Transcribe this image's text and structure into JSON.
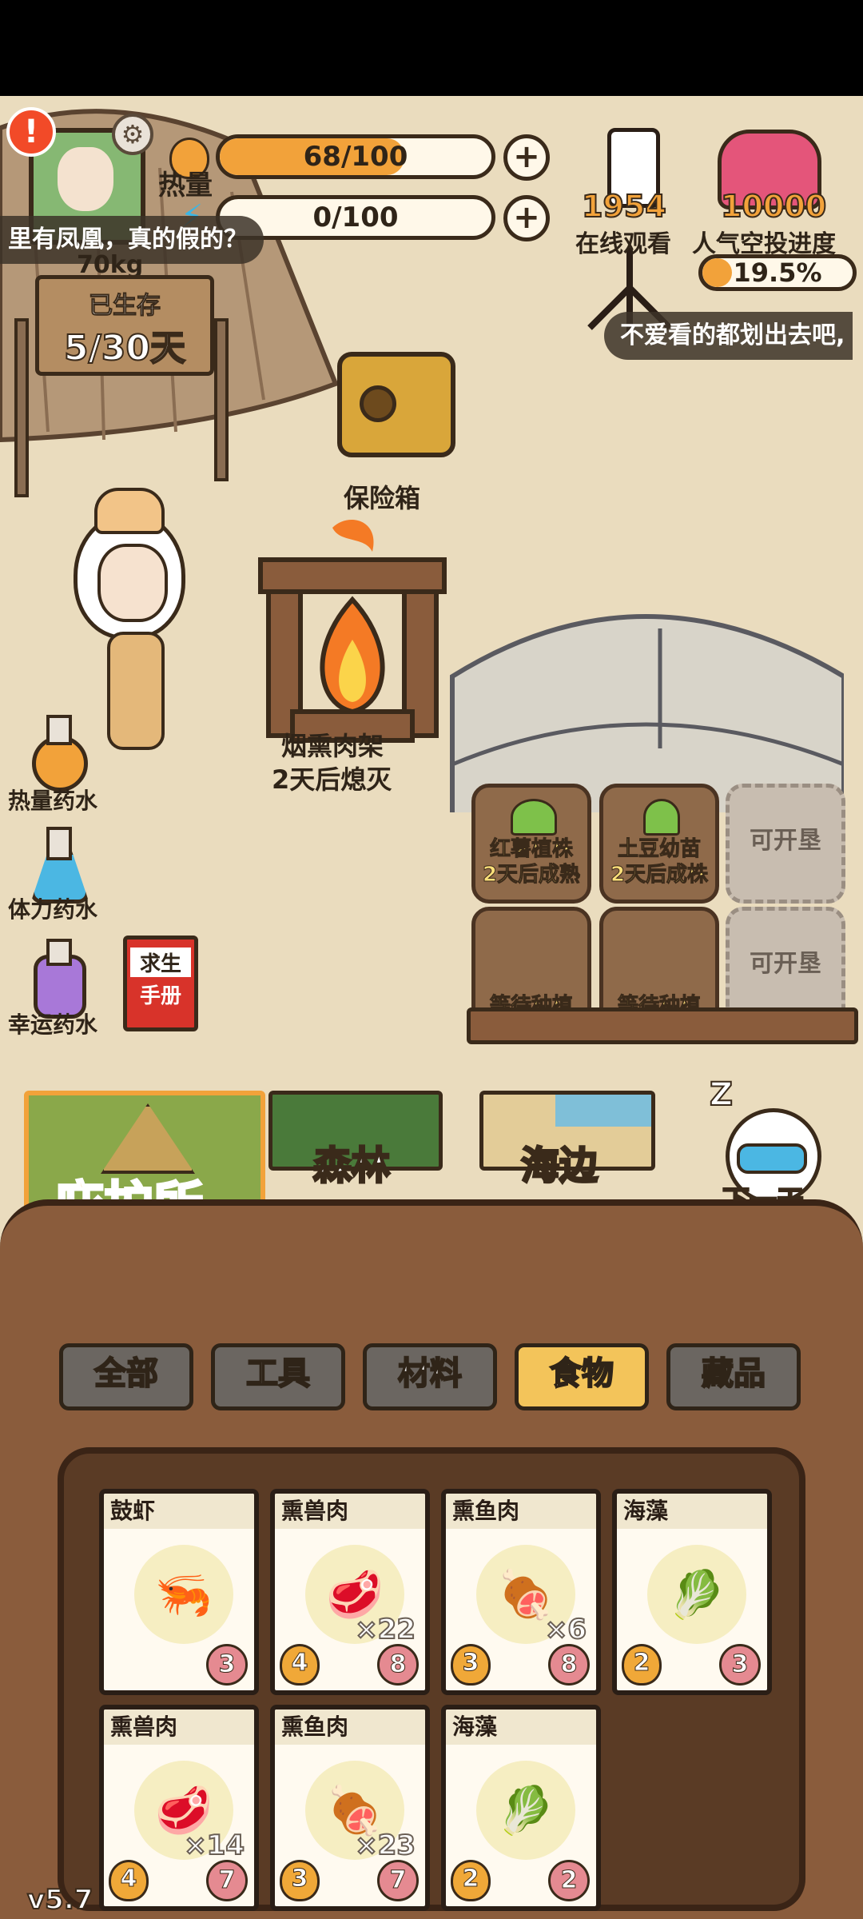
{
  "status": {
    "heat_label": "热量",
    "heat_value": "68/100",
    "heat_fraction": 0.68,
    "stamina_value": "0/100",
    "stamina_fraction": 0.0,
    "weight_partial": "70kg"
  },
  "survival": {
    "title": "已生存",
    "days": "5/30天"
  },
  "chat": {
    "left_message": "里有凤凰，真的假的？",
    "right_message": "不爱看的都划出去吧,"
  },
  "stream": {
    "viewers": "1954",
    "viewers_label": "在线观看",
    "airdrop_value": "10000",
    "airdrop_label": "人气空投进度",
    "airdrop_percent": "19.5%",
    "airdrop_fraction": 0.195
  },
  "scene": {
    "safe_label": "保险箱",
    "smoker_label": "烟熏肉架",
    "smoker_status": "2天后熄灭",
    "plots": [
      {
        "line1": "红薯植株",
        "line2": "2天后成熟",
        "locked": false
      },
      {
        "line1": "土豆幼苗",
        "line2": "2天后成株",
        "locked": false
      },
      {
        "line1": "可开垦",
        "line2": "",
        "locked": true
      },
      {
        "line1": "等待种植",
        "line2": "",
        "locked": false
      },
      {
        "line1": "等待种植",
        "line2": "",
        "locked": false
      },
      {
        "line1": "可开垦",
        "line2": "",
        "locked": true
      }
    ]
  },
  "potions": {
    "heat": "热量药水",
    "stamina": "体力药水",
    "luck": "幸运药水"
  },
  "manual": {
    "line1": "求生",
    "line2": "手册"
  },
  "areas": {
    "shelter": "庇护所",
    "forest": "森林",
    "beach": "海边",
    "next_day": "下一天"
  },
  "tabs": [
    "全部",
    "工具",
    "材料",
    "食物",
    "藏品"
  ],
  "active_tab": "食物",
  "inventory": [
    {
      "name": "鼓虾",
      "icon": "🦐",
      "qty": "",
      "heat": "",
      "stamina": "3"
    },
    {
      "name": "熏兽肉",
      "icon": "🥩",
      "qty": "×22",
      "heat": "4",
      "stamina": "8"
    },
    {
      "name": "熏鱼肉",
      "icon": "🍖",
      "qty": "×6",
      "heat": "3",
      "stamina": "8"
    },
    {
      "name": "海藻",
      "icon": "🥬",
      "qty": "",
      "heat": "2",
      "stamina": "3"
    },
    {
      "name": "熏兽肉",
      "icon": "🥩",
      "qty": "×14",
      "heat": "4",
      "stamina": "7"
    },
    {
      "name": "熏鱼肉",
      "icon": "🍖",
      "qty": "×23",
      "heat": "3",
      "stamina": "7"
    },
    {
      "name": "海藻",
      "icon": "🥬",
      "qty": "",
      "heat": "2",
      "stamina": "2"
    }
  ],
  "version": "v5.7",
  "colors": {
    "ground": "#eadcbe",
    "accent_orange": "#f2a23a",
    "panel_brown": "#5a3b25",
    "tab_active": "#f3c45a"
  }
}
